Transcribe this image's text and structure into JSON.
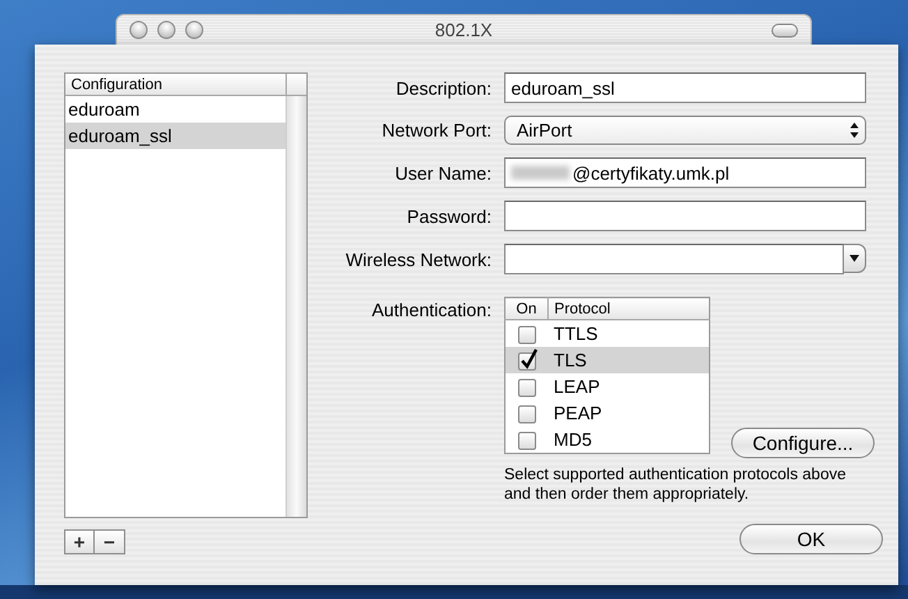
{
  "window": {
    "title": "802.1X"
  },
  "configurations": {
    "header": "Configuration",
    "items": [
      {
        "label": "eduroam",
        "selected": false
      },
      {
        "label": "eduroam_ssl",
        "selected": true
      }
    ],
    "buttons": [
      "+",
      "−"
    ]
  },
  "fields": [
    {
      "kind": "text",
      "label": "Description:",
      "value": "eduroam_ssl"
    },
    {
      "kind": "popup",
      "label": "Network Port:",
      "value": "AirPort"
    },
    {
      "kind": "text",
      "label": "User Name:",
      "value": "@certyfikaty.umk.pl",
      "redacted": true
    },
    {
      "kind": "text",
      "label": "Password:"
    },
    {
      "kind": "combo",
      "label": "Wireless Network:"
    }
  ],
  "authentication": {
    "label": "Authentication:",
    "columns": [
      "On",
      "Protocol"
    ],
    "protocols": [
      {
        "name": "TTLS",
        "on": false,
        "selected": false
      },
      {
        "name": "TLS",
        "on": true,
        "selected": true
      },
      {
        "name": "LEAP",
        "on": false,
        "selected": false
      },
      {
        "name": "PEAP",
        "on": false,
        "selected": false
      },
      {
        "name": "MD5",
        "on": false,
        "selected": false
      }
    ],
    "configure_button": "Configure...",
    "help": "Select supported authentication protocols above and then order them appropriately."
  },
  "ok_button": "OK"
}
